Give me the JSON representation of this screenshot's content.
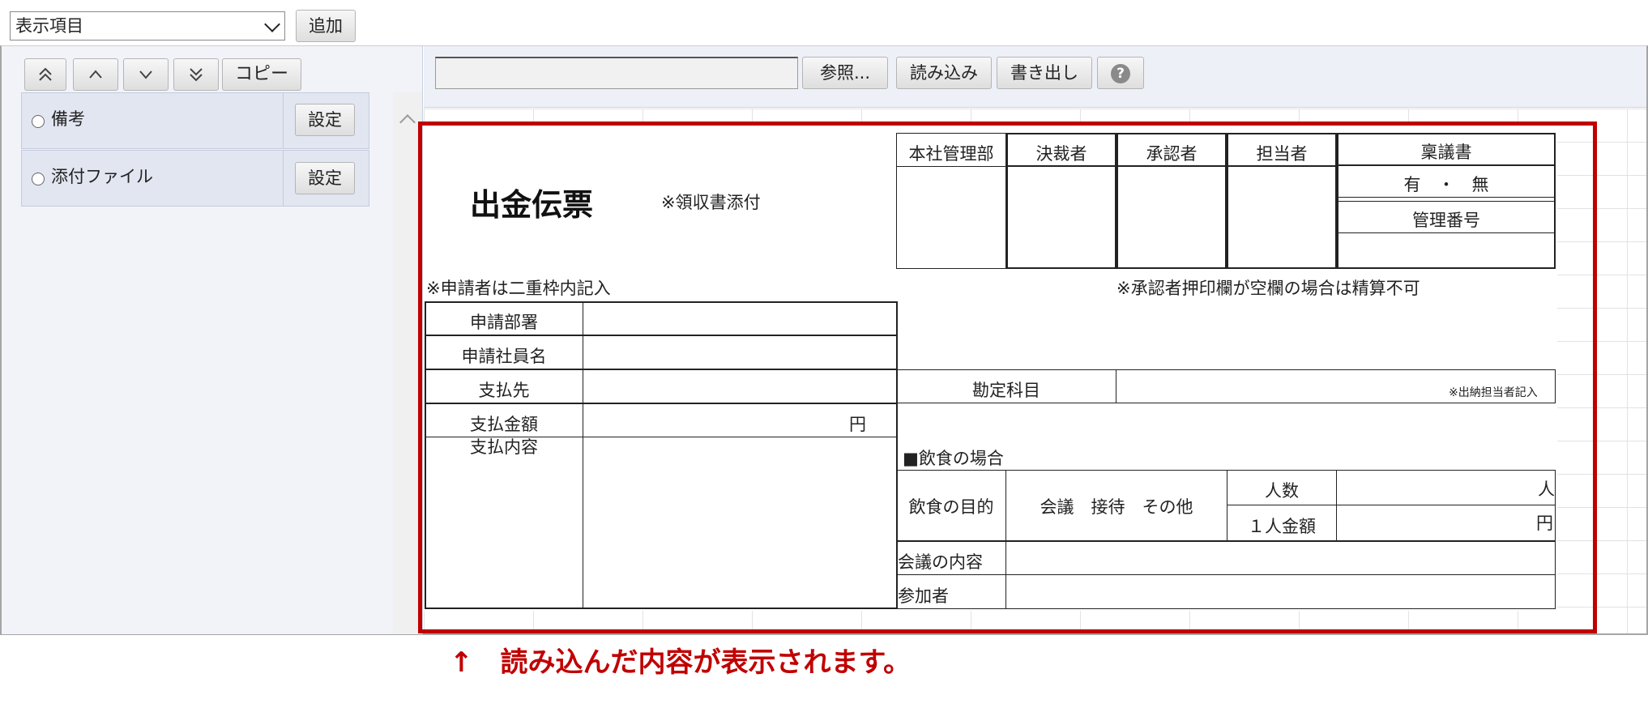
{
  "top": {
    "display_select_value": "表示項目",
    "add_label": "追加"
  },
  "left": {
    "copy_label": "コピー",
    "items": [
      {
        "label": "備考",
        "button": "設定"
      },
      {
        "label": "添付ファイル",
        "button": "設定"
      }
    ]
  },
  "right_toolbar": {
    "browse_label": "参照...",
    "import_label": "読み込み",
    "export_label": "書き出し",
    "help_icon": "?"
  },
  "form": {
    "title": "出金伝票",
    "receipt_note": "※領収書添付",
    "approval_headers": [
      "本社管理部",
      "決裁者",
      "承認者",
      "担当者"
    ],
    "ringi_label": "稟議書",
    "ringi_options": "有　・　無",
    "mgmt_number_label": "管理番号",
    "applicant_note": "※申請者は二重枠内記入",
    "approver_note": "※承認者押印欄が空欄の場合は精算不可",
    "fields": {
      "department": "申請部署",
      "employee": "申請社員名",
      "payee": "支払先",
      "amount": "支払金額",
      "yen": "円",
      "content": "支払内容"
    },
    "account_label": "勘定科目",
    "cashier_note": "※出納担当者記入",
    "dining_header": "■飲食の場合",
    "dining_purpose_label": "飲食の目的",
    "dining_purpose_options": "会議　接待　その他",
    "people_label": "人数",
    "people_unit": "人",
    "per_person_label": "１人金額",
    "per_person_unit": "円",
    "meeting_content_label": "会議の内容",
    "participants_label": "参加者"
  },
  "caption": "↑　読み込んだ内容が表示されます。",
  "colors": {
    "highlight": "#c00000",
    "pane_bg": "#f2f3f8",
    "row_bg": "#e2e6f1"
  }
}
